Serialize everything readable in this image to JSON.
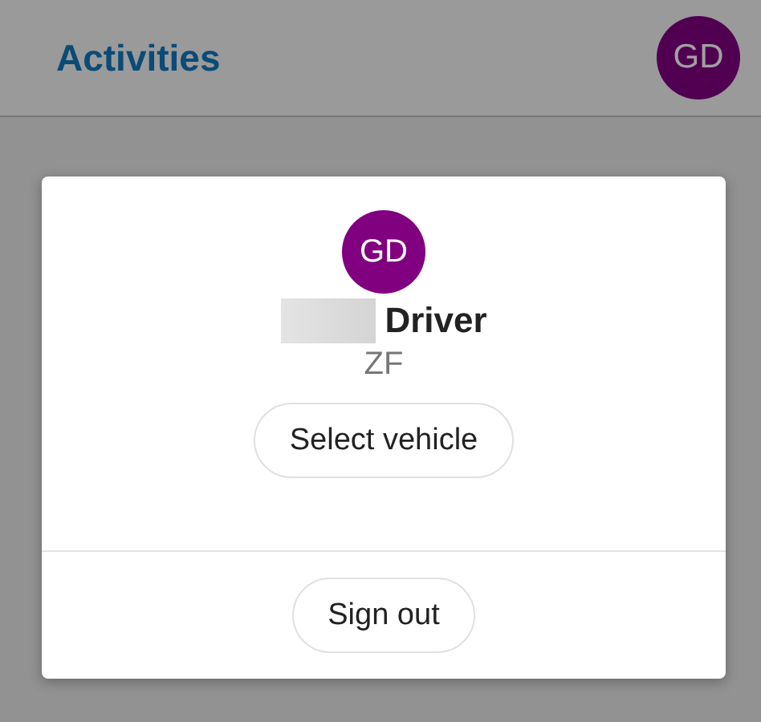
{
  "header": {
    "title": "Activities",
    "avatar_initials": "GD"
  },
  "dialog": {
    "avatar_initials": "GD",
    "name": "Driver",
    "company": "ZF",
    "buttons": [
      {
        "label": "Select vehicle",
        "kind": "primary"
      },
      {
        "label": "Sign out",
        "kind": "footer"
      }
    ]
  }
}
